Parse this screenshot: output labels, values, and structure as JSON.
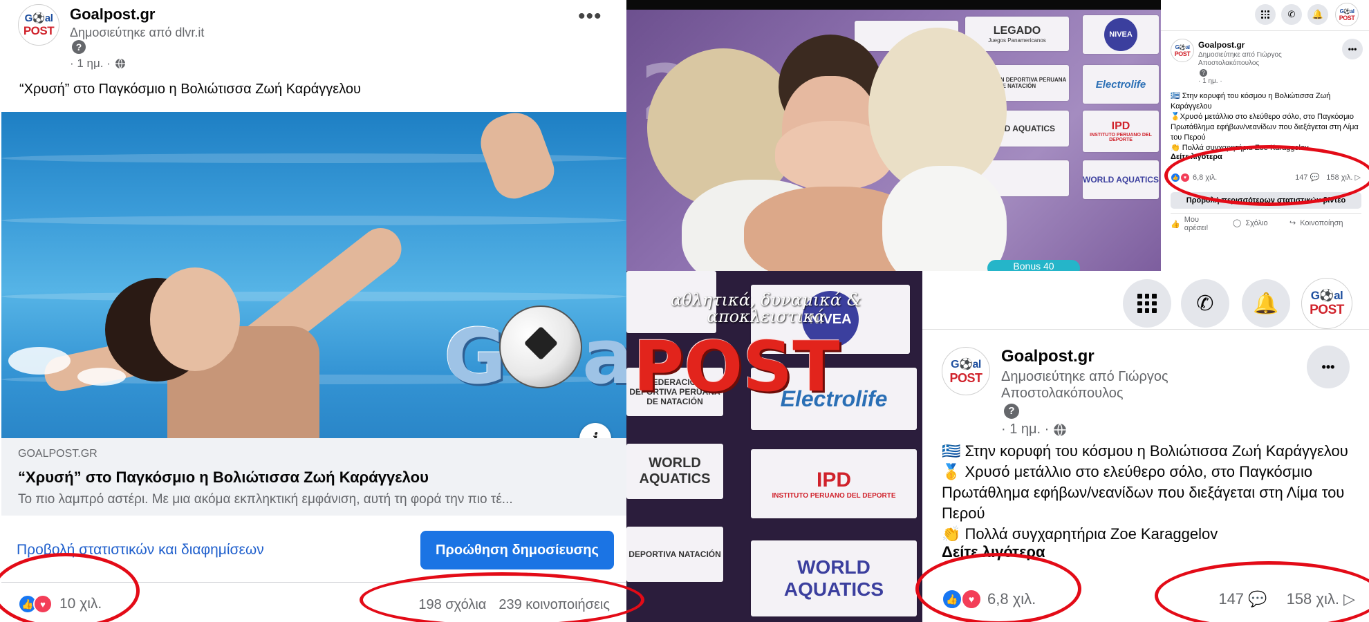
{
  "left_post": {
    "page_name": "Goalpost.gr",
    "published_by": "Δημοσιεύτηκε από dlvr.it",
    "help_mark": "?",
    "time": "· 1 ημ. ·",
    "more": "•••",
    "caption": "“Χρυσή” στο Παγκόσμιο η Βολιώτισσα Ζωή Καράγγελου",
    "logo": {
      "line1": "G⚽al",
      "line2": "POST"
    },
    "watermark": {
      "left": "G",
      "mid": "al",
      "right": "POST"
    },
    "info": "i",
    "link_domain": "GOALPOST.GR",
    "link_title": "“Χρυσή” στο Παγκόσμιο η Βολιώτισσα Ζωή Καράγγελου",
    "link_description": "Το πιο λαμπρό αστέρι. Με μια ακόμα εκπληκτική εμφάνιση, αυτή τη φορά την πιο τέ...",
    "stats_link": "Προβολή στατιστικών και διαφημίσεων",
    "boost_button": "Προώθηση δημοσίευσης",
    "reactions_count": "10 χιλ.",
    "comments": "198 σχόλια",
    "shares": "239 κοινοποιήσεις"
  },
  "video_top": {
    "sponsor_legado": "LEGADO",
    "sponsor_legado_sub": "Juegos Panamericanos",
    "sponsor_nivea": "NIVEA",
    "sponsor_fed": "FEDERACIÓN DEPORTIVA PERUANA DE NATACIÓN",
    "sponsor_electrolife": "Electrolife",
    "sponsor_wa": "WORLD AQUATICS",
    "sponsor_ipd": "IPD",
    "sponsor_ipd_sub": "INSTITUTO PERUANO DEL DEPORTE",
    "sponsor_wa2": "WORLD AQUATICS",
    "bottom_tag": "Bonus 40"
  },
  "video_bottom": {
    "overlay_text": "αθλητικά, δυναμικά & αποκλειστικά",
    "sponsor_nivea": "NIVEA",
    "sponsor_fed": "FEDERACIÓN DEPORTIVA PERUANA DE NATACIÓN",
    "sponsor_electrolife": "Electrolife",
    "sponsor_wa": "WORLD AQUATICS",
    "sponsor_ipd": "IPD",
    "sponsor_ipd_sub": "INSTITUTO PERUANO DEL DEPORTE",
    "sponsor_wa2": "WORLD AQUATICS",
    "sponsor_fed2": "DEPORTIVA NATACIÓN"
  },
  "small_post": {
    "page_name": "Goalpost.gr",
    "published_by": "Δημοσιεύτηκε από Γιώργος Αποστολακόπουλος",
    "help_mark": "?",
    "time": "· 1 ημ. ·",
    "line1": "🇬🇷 Στην κορυφή του κόσμου η Βολιώτισσα Ζωή Καράγγελου",
    "line2": "🥇Χρυσό μετάλλιο στο ελεύθερο σόλο, στο Παγκόσμιο Πρωτάθλημα εφήβων/νεανίδων που διεξάγεται στη Λίμα του Περού",
    "line3": "👏 Πολλά συγχαρητήρια Zoe Karaggelov",
    "see_more": "Δείτε λιγότερα",
    "reactions_count": "6,8 χιλ.",
    "comments_count": "147",
    "views": "158 χιλ.",
    "insights_button": "Προβολή περισσότερων στατιστικών βίντεο",
    "like": "Μου αρέσει!",
    "comment": "Σχόλιο",
    "share": "Κοινοποίηση"
  },
  "large_post": {
    "page_name": "Goalpost.gr",
    "published_by_1": "Δημοσιεύτηκε από Γιώργος",
    "published_by_2": "Αποστολακόπουλος",
    "help_mark": "?",
    "time": "· 1 ημ. ·",
    "more": "•••",
    "line1": "🇬🇷 Στην κορυφή του κόσμου η Βολιώτισσα Ζωή Καράγγελου",
    "line2": "🥇 Χρυσό μετάλλιο στο ελεύθερο σόλο, στο Παγκόσμιο Πρωτάθλημα εφήβων/νεανίδων που διεξάγεται στη Λίμα του Περού",
    "line3": "👏 Πολλά συγχαρητήρια Zoe Karaggelov",
    "see_more": "Δείτε λιγότερα",
    "reactions_count": "6,8 χιλ.",
    "comments_count": "147",
    "views": "158 χιλ."
  },
  "colors": {
    "facebook_blue": "#1b74e4",
    "link_blue": "#1f5fcc",
    "annotation_red": "#e30b17",
    "like_blue": "#1877f2",
    "love_red": "#f33e58",
    "secondary_text": "#65676b"
  }
}
